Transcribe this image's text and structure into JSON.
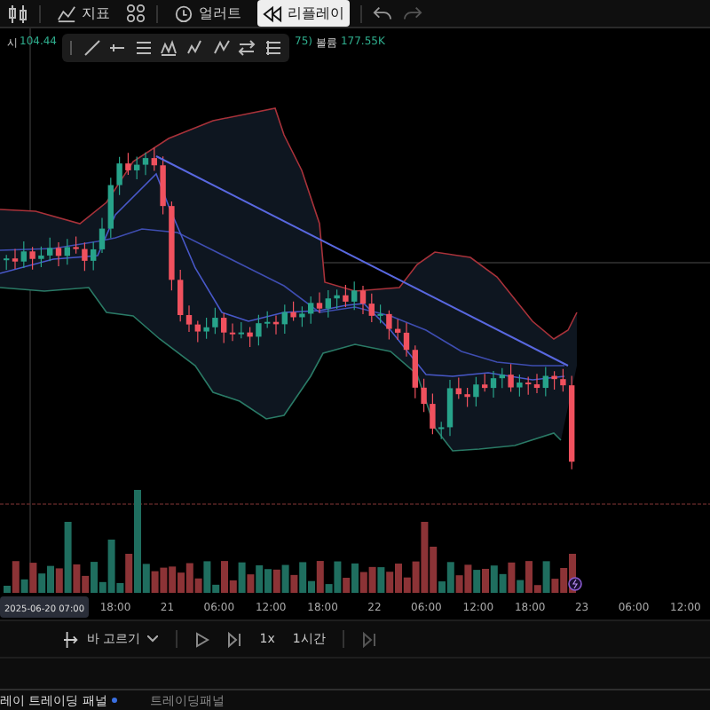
{
  "toolbar": {
    "indicators_label": "지표",
    "alerts_label": "얼러트",
    "replay": {
      "label": "리플레이",
      "selected": true
    }
  },
  "legend": {
    "open_label": "시",
    "open_value": "104.44",
    "partial_text": "75)",
    "volume_label": "볼륨",
    "volume_value": "177.55K"
  },
  "time_axis": {
    "highlight": "2025-06-20  07:00",
    "ticks": [
      "18:00",
      "21",
      "06:00",
      "12:00",
      "18:00",
      "22",
      "06:00",
      "12:00",
      "18:00",
      "23",
      "06:00",
      "12:00"
    ]
  },
  "replay_bar": {
    "bar_select": "바 고르기",
    "speed": "1x",
    "interval": "1시간"
  },
  "bottom_tabs": [
    {
      "label": "레이 트레이딩 패널",
      "selected": true
    },
    {
      "label": "트레이딩패널",
      "selected": false
    }
  ]
}
